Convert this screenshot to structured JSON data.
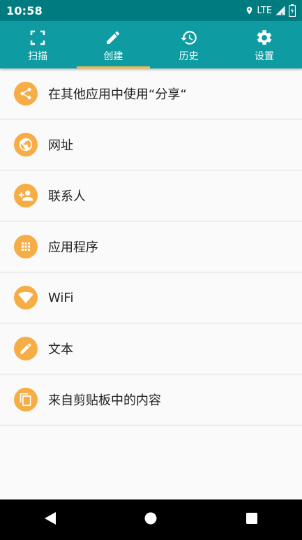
{
  "status_bar": {
    "time": "10:58",
    "network": "LTE",
    "icons": [
      "location-icon",
      "signal-icon",
      "battery-icon"
    ]
  },
  "tabs": [
    {
      "label": "扫描",
      "icon": "scan-icon",
      "active": false
    },
    {
      "label": "创建",
      "icon": "pencil-icon",
      "active": true
    },
    {
      "label": "历史",
      "icon": "history-icon",
      "active": false
    },
    {
      "label": "设置",
      "icon": "gear-icon",
      "active": false
    }
  ],
  "items": [
    {
      "label": "在其他应用中使用“分享“",
      "icon": "share-icon"
    },
    {
      "label": "网址",
      "icon": "globe-icon"
    },
    {
      "label": "联系人",
      "icon": "add-contact-icon"
    },
    {
      "label": "应用程序",
      "icon": "apps-grid-icon"
    },
    {
      "label": "WiFi",
      "icon": "wifi-icon"
    },
    {
      "label": "文本",
      "icon": "pencil-icon"
    },
    {
      "label": "来自剪贴板中的内容",
      "icon": "clipboard-copy-icon"
    }
  ],
  "nav_bar": {
    "buttons": [
      "back-icon",
      "home-icon",
      "recents-icon"
    ]
  },
  "colors": {
    "status_bar": "#007c80",
    "toolbar": "#0e9ca2",
    "tab_indicator": "#f5b942",
    "item_icon_bg": "#f6ad45",
    "list_bg": "#fafafa"
  }
}
